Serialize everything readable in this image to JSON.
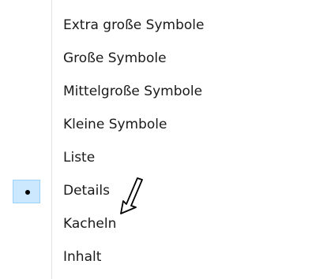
{
  "menu": {
    "items": [
      {
        "label": "Extra große Symbole",
        "selected": false
      },
      {
        "label": "Große Symbole",
        "selected": false
      },
      {
        "label": "Mittelgroße Symbole",
        "selected": false
      },
      {
        "label": "Kleine Symbole",
        "selected": false
      },
      {
        "label": "Liste",
        "selected": false
      },
      {
        "label": "Details",
        "selected": true
      },
      {
        "label": "Kacheln",
        "selected": false
      },
      {
        "label": "Inhalt",
        "selected": false
      }
    ]
  },
  "colors": {
    "selection_fill": "#cce8ff",
    "selection_border": "#99d1ff",
    "text": "#1a1a1a",
    "divider": "#e3e3e3"
  },
  "icons": {
    "selected_marker": "bullet-dot",
    "pointer": "mouse-pointer-icon"
  }
}
